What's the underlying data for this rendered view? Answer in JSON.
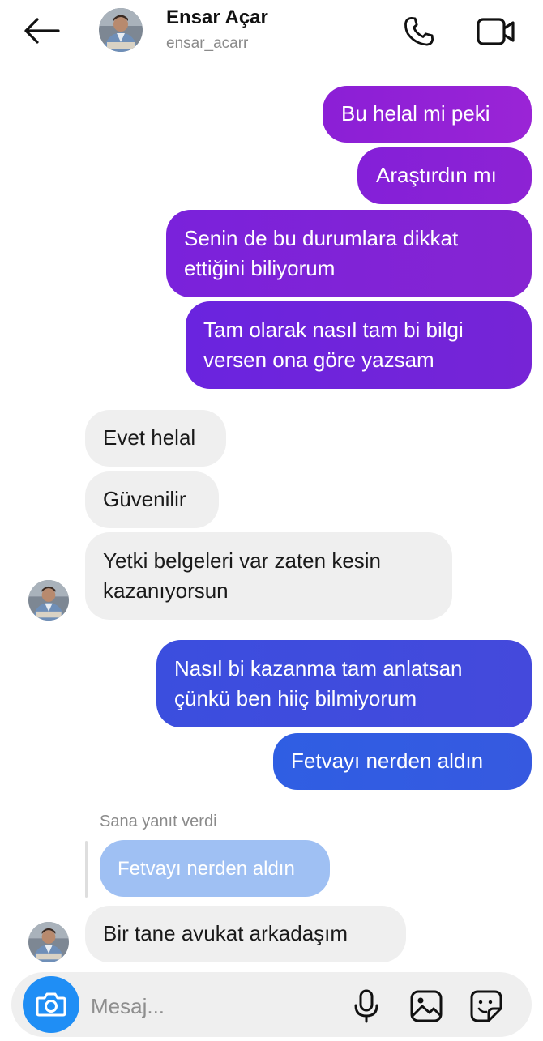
{
  "header": {
    "name": "Ensar Açar",
    "username": "ensar_acarr",
    "back_icon": "arrow-left-icon",
    "call_icon": "phone-icon",
    "video_icon": "video-camera-icon"
  },
  "messages": [
    {
      "from": "me",
      "text": "Bu helal mi peki"
    },
    {
      "from": "me",
      "text": "Araştırdın mı"
    },
    {
      "from": "me",
      "text": "Senin de bu durumlara dikkat ettiğini biliyorum"
    },
    {
      "from": "me",
      "text": "Tam olarak nasıl tam bi bilgi versen ona göre yazsam"
    },
    {
      "from": "them",
      "text": "Evet helal"
    },
    {
      "from": "them",
      "text": "Güvenilir"
    },
    {
      "from": "them",
      "text": "Yetki belgeleri var zaten kesin kazanıyorsun"
    },
    {
      "from": "me",
      "text": "Nasıl bi kazanma tam anlatsan çünkü ben hiiç  bilmiyorum"
    },
    {
      "from": "me",
      "text": "Fetvayı nerden aldın"
    },
    {
      "from": "them",
      "text": "Bir tane avukat arkadaşım"
    }
  ],
  "reply": {
    "label": "Sana yanıt verdi",
    "quoted": "Fetvayı nerden aldın"
  },
  "composer": {
    "placeholder": "Mesaj...",
    "value": "",
    "camera_icon": "camera-icon",
    "mic_icon": "microphone-icon",
    "gallery_icon": "image-icon",
    "sticker_icon": "sticker-icon"
  },
  "colors": {
    "sent_purple": "#8b1fd6",
    "sent_blue": "#3659e0",
    "received_bg": "#efefef",
    "reply_quote_bg": "#9fc0f3",
    "camera_button": "#1f8ef5"
  }
}
